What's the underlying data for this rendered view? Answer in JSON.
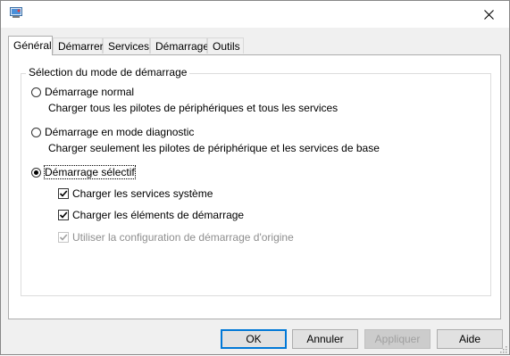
{
  "window": {
    "title": "",
    "icon": "msconfig-icon"
  },
  "tabs": [
    {
      "label": "Général",
      "active": true
    },
    {
      "label": "Démarrer",
      "active": false
    },
    {
      "label": "Services",
      "active": false
    },
    {
      "label": "Démarrage",
      "active": false
    },
    {
      "label": "Outils",
      "active": false
    }
  ],
  "startup_selection": {
    "legend": "Sélection du mode de démarrage",
    "options": [
      {
        "label": "Démarrage normal",
        "description": "Charger tous les pilotes de périphériques et tous les services",
        "selected": false
      },
      {
        "label": "Démarrage en mode diagnostic",
        "description": "Charger seulement les pilotes de périphérique et les services de base",
        "selected": false
      },
      {
        "label": "Démarrage sélectif",
        "description": "",
        "selected": true
      }
    ],
    "selective_options": [
      {
        "label": "Charger les services système",
        "checked": true,
        "enabled": true
      },
      {
        "label": "Charger les éléments de démarrage",
        "checked": true,
        "enabled": true
      },
      {
        "label": "Utiliser la configuration de démarrage d'origine",
        "checked": true,
        "enabled": false
      }
    ]
  },
  "buttons": {
    "ok": "OK",
    "cancel": "Annuler",
    "apply": "Appliquer",
    "help": "Aide"
  },
  "colors": {
    "accent": "#0078d7",
    "disabled_text": "#8e8e8e"
  }
}
